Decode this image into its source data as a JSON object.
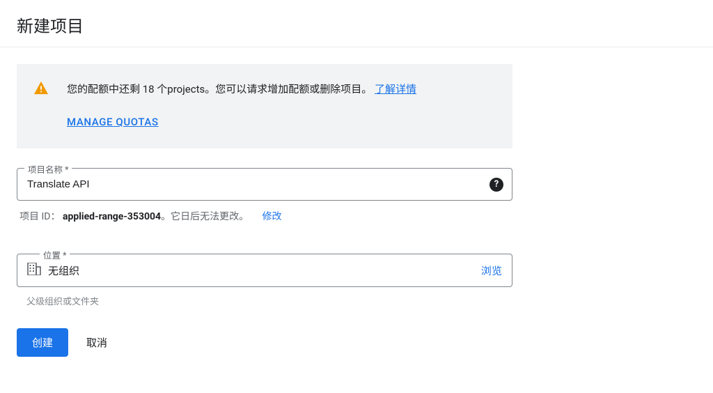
{
  "header": {
    "title": "新建项目"
  },
  "alert": {
    "text": "您的配额中还剩 18 个projects。您可以请求增加配额或删除项目。",
    "learn_more": "了解详情",
    "manage_quotas": "MANAGE QUOTAS"
  },
  "project_name": {
    "label": "项目名称 *",
    "value": "Translate API"
  },
  "project_id": {
    "label": "项目 ID：",
    "value": "applied-range-353004",
    "note": "。它日后无法更改。",
    "edit": "修改"
  },
  "location": {
    "label": "位置 *",
    "value": "无组织",
    "browse": "浏览",
    "helper": "父级组织或文件夹"
  },
  "buttons": {
    "create": "创建",
    "cancel": "取消"
  }
}
